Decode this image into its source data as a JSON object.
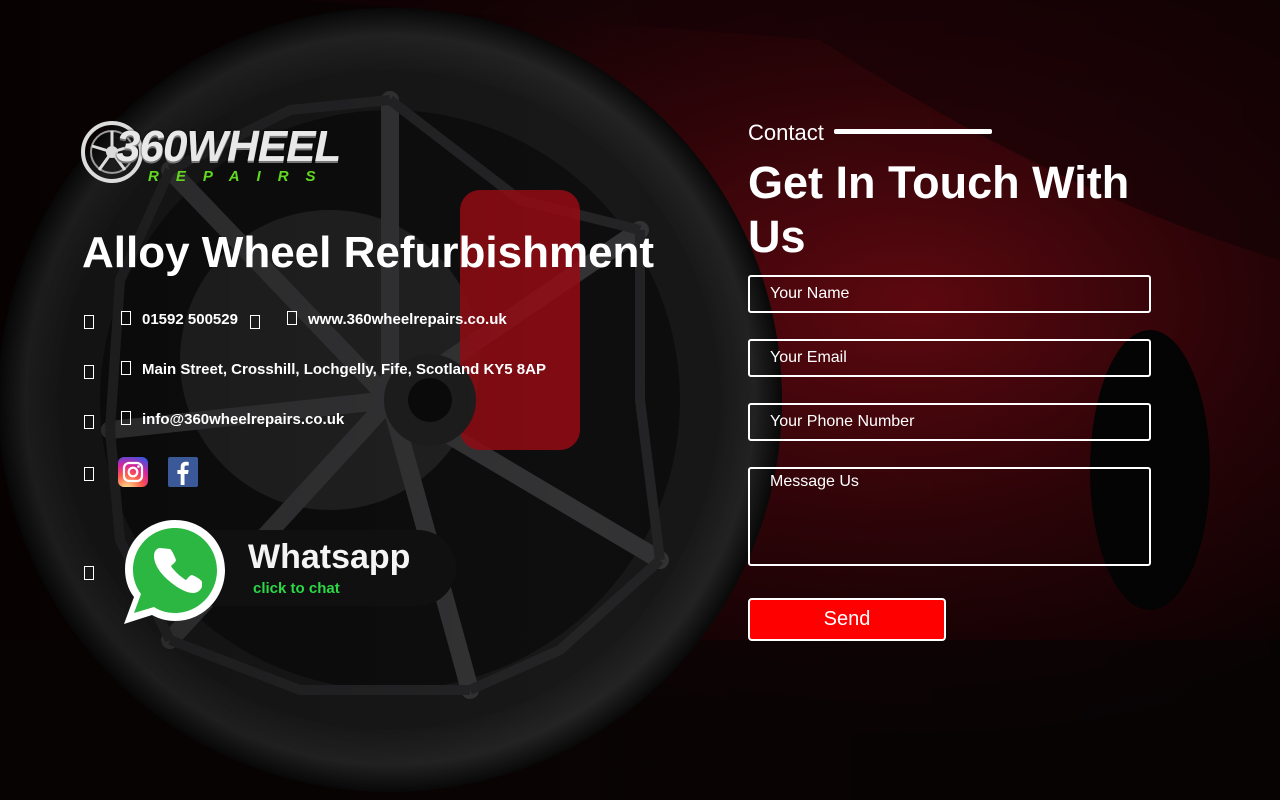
{
  "logo": {
    "word": "360WHEEL",
    "sub": "REPAIRS"
  },
  "headline": "Alloy Wheel Refurbishment",
  "contact_info": {
    "phone": "01592 500529",
    "website": "www.360wheelrepairs.co.uk",
    "address": "Main Street, Crosshill, Lochgelly, Fife, Scotland KY5 8AP",
    "email": "info@360wheelrepairs.co.uk"
  },
  "social": {
    "instagram": "instagram-icon",
    "facebook": "facebook-icon"
  },
  "whatsapp": {
    "title": "Whatsapp",
    "subtitle": "click to chat",
    "color": "#2bd846"
  },
  "contact_form": {
    "label": "Contact",
    "title": "Get In Touch With Us",
    "name_placeholder": "Your Name",
    "email_placeholder": "Your Email",
    "phone_placeholder": "Your Phone Number",
    "message_placeholder": "Message Us",
    "send_label": "Send",
    "send_color": "#ff0000"
  }
}
